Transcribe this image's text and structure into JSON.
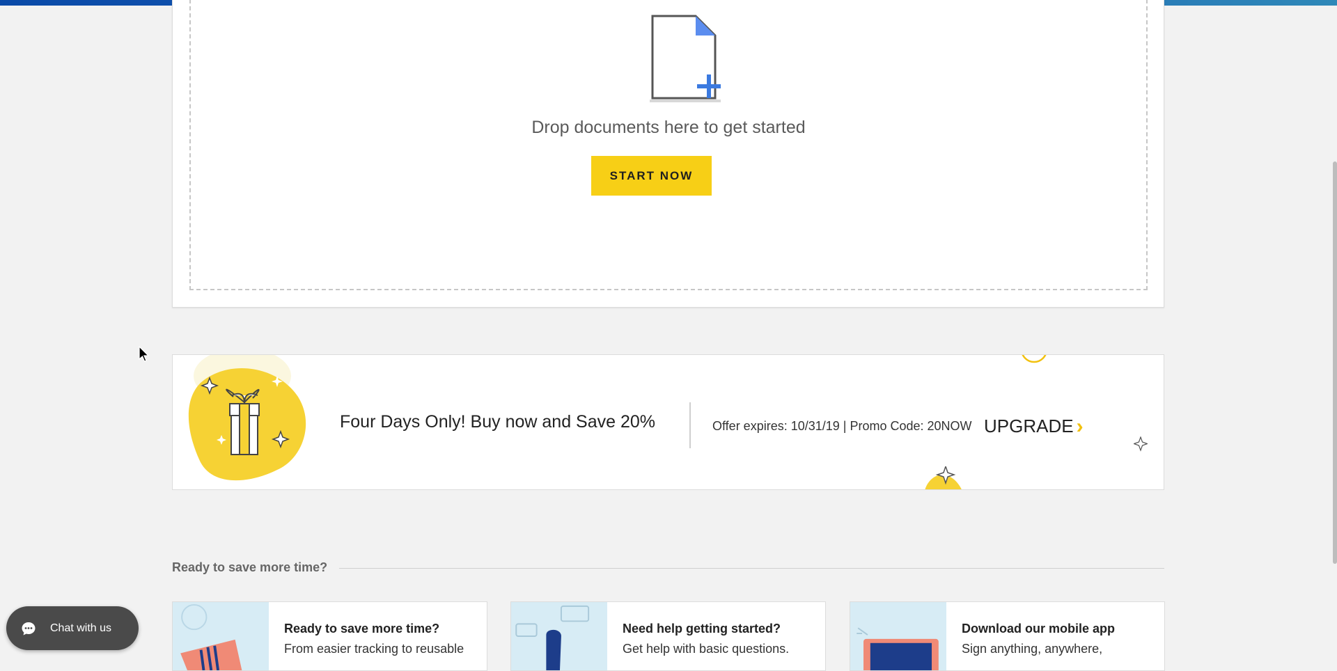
{
  "upload": {
    "drop_text": "Drop documents here to get started",
    "start_button": "START NOW"
  },
  "promo": {
    "headline": "Four Days Only! Buy now and Save 20%",
    "offer": "Offer expires: 10/31/19 | Promo Code: 20NOW",
    "upgrade_label": "UPGRADE",
    "chevron": "›"
  },
  "section": {
    "title": "Ready to save more time?"
  },
  "cards": [
    {
      "title": "Ready to save more time?",
      "desc": "From easier tracking to reusable"
    },
    {
      "title": "Need help getting started?",
      "desc": "Get help with basic questions."
    },
    {
      "title": "Download our mobile app",
      "desc": "Sign anything, anywhere,"
    }
  ],
  "chat": {
    "label": "Chat with us"
  },
  "colors": {
    "accent_yellow": "#f7cf16",
    "brand_blue": "#0a4aa8",
    "doc_plus_blue": "#3b7ae0"
  }
}
